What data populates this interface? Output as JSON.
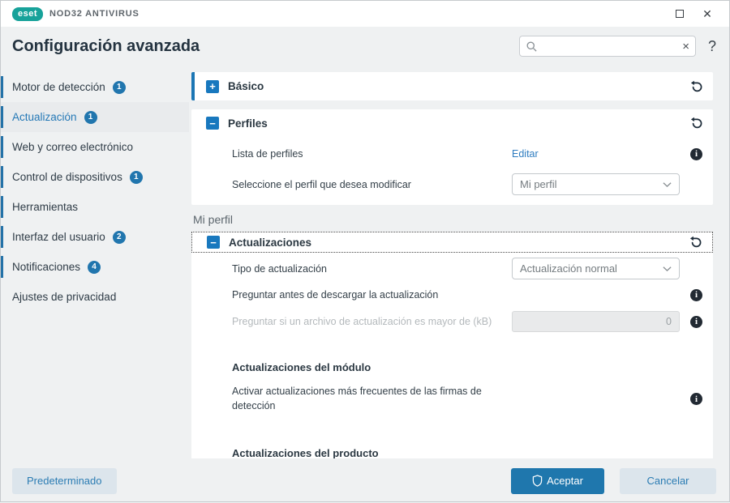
{
  "window": {
    "brand": "eset",
    "product": "NOD32 ANTIVIRUS",
    "close_glyph": "✕"
  },
  "header": {
    "title": "Configuración avanzada",
    "search_value": "",
    "clear_glyph": "×",
    "help_glyph": "?"
  },
  "sidebar": {
    "items": [
      {
        "label": "Motor de detección",
        "badge": "1"
      },
      {
        "label": "Actualización",
        "badge": "1"
      },
      {
        "label": "Web y correo electrónico"
      },
      {
        "label": "Control de dispositivos",
        "badge": "1"
      },
      {
        "label": "Herramientas"
      },
      {
        "label": "Interfaz del usuario",
        "badge": "2"
      },
      {
        "label": "Notificaciones",
        "badge": "4"
      },
      {
        "label": "Ajustes de privacidad"
      }
    ]
  },
  "content": {
    "basico": {
      "title": "Básico",
      "expand_glyph": "+"
    },
    "perfiles": {
      "title": "Perfiles",
      "collapse_glyph": "−",
      "lista_label": "Lista de perfiles",
      "editar_link": "Editar",
      "select_label": "Seleccione el perfil que desea modificar",
      "profile_value": "Mi perfil",
      "info_glyph": "i"
    },
    "group_label": "Mi perfil",
    "actualizaciones": {
      "title": "Actualizaciones",
      "collapse_glyph": "−",
      "tipo_label": "Tipo de actualización",
      "tipo_value": "Actualización normal",
      "preguntar_label": "Preguntar antes de descargar la actualización",
      "preguntar_kb_label": "Preguntar si un archivo de actualización es mayor de (kB)",
      "kb_value": "0",
      "modulo_heading": "Actualizaciones del módulo",
      "firmas_label": "Activar actualizaciones más frecuentes de las firmas de detección",
      "producto_heading": "Actualizaciones del producto",
      "info_glyph": "i"
    }
  },
  "footer": {
    "default_label": "Predeterminado",
    "ok_label": "Aceptar",
    "cancel_label": "Cancelar"
  },
  "colors": {
    "brand_teal": "#17a29a",
    "accent_blue": "#2176ae",
    "link_blue": "#2e7cc0",
    "toggle_on": "#2279ae",
    "selected_text": "#2478b6",
    "card_bg": "#ffffff",
    "page_bg": "#eff1f2"
  }
}
